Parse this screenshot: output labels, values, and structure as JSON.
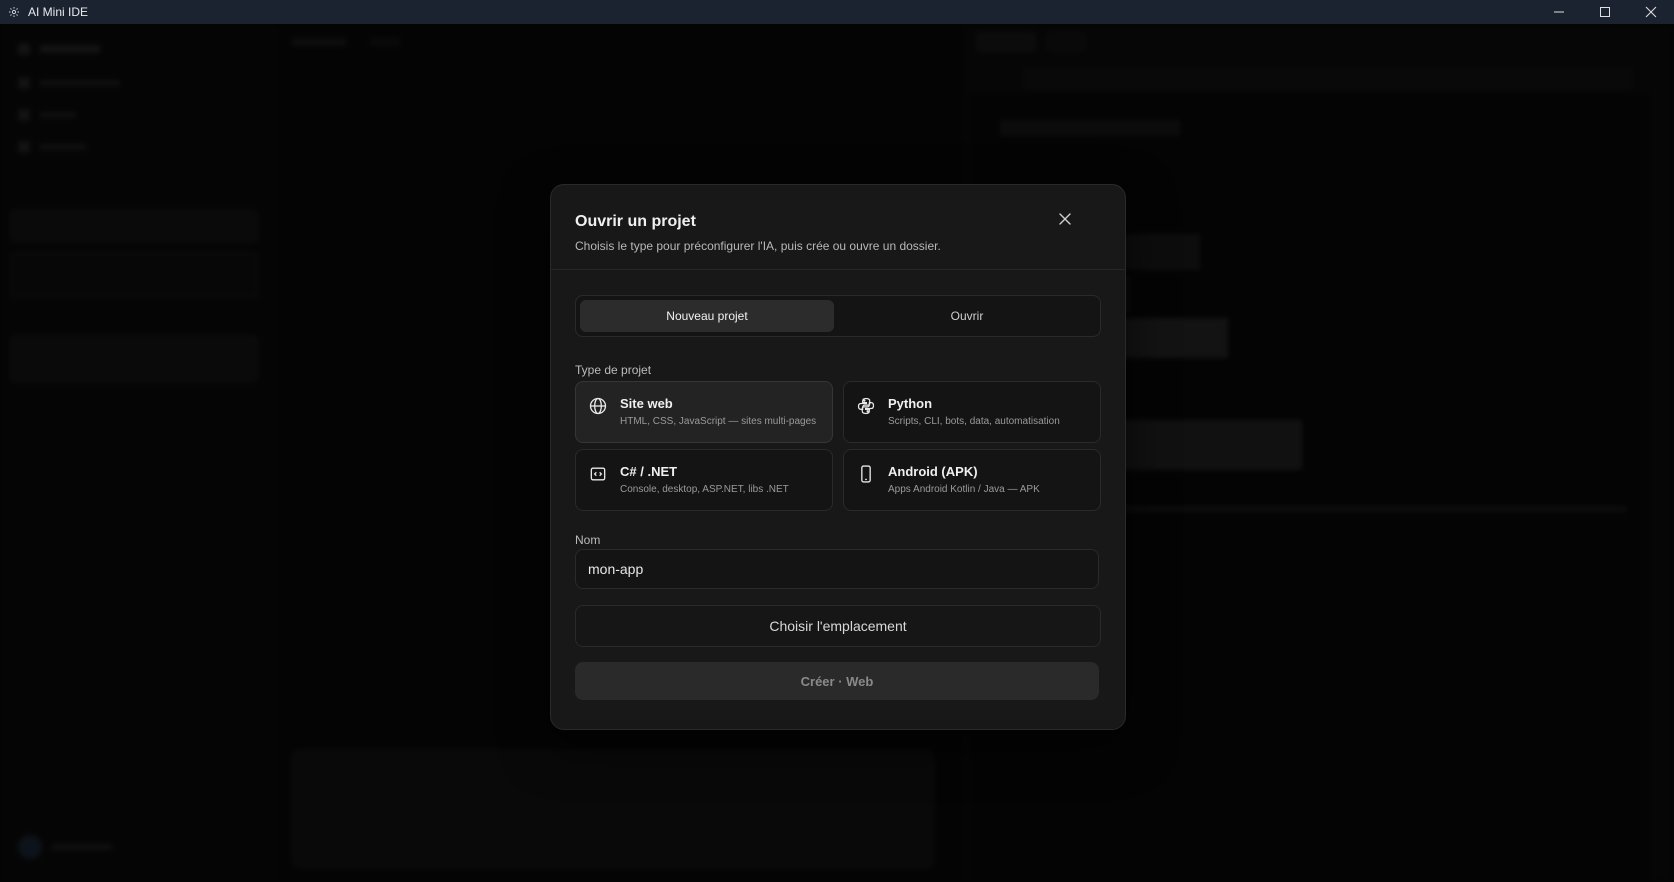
{
  "window": {
    "title": "AI Mini IDE",
    "app_icon": "gear-icon",
    "controls": [
      "minimize-icon",
      "maximize-icon",
      "close-icon"
    ]
  },
  "dialog": {
    "title": "Ouvrir un projet",
    "subtitle": "Choisis le type pour préconfigurer l'IA, puis crée ou ouvre un dossier.",
    "close_icon": "close-icon",
    "tabs": [
      {
        "label": "Nouveau projet",
        "active": true
      },
      {
        "label": "Ouvrir",
        "active": false
      }
    ],
    "project_type_label": "Type de projet",
    "project_types": [
      {
        "title": "Site web",
        "description": "HTML, CSS, JavaScript — sites multi-pages",
        "icon": "globe-icon",
        "selected": true
      },
      {
        "title": "Python",
        "description": "Scripts, CLI, bots, data, automatisation",
        "icon": "python-icon",
        "selected": false
      },
      {
        "title": "C# / .NET",
        "description": "Console, desktop, ASP.NET, libs .NET",
        "icon": "code-window-icon",
        "selected": false
      },
      {
        "title": "Android (APK)",
        "description": "Apps Android Kotlin / Java — APK",
        "icon": "smartphone-icon",
        "selected": false
      }
    ],
    "name_label": "Nom",
    "name_value": "mon-app",
    "choose_location_label": "Choisir l'emplacement",
    "create_label": "Créer · Web"
  },
  "colors": {
    "titlebar_bg": "#1c2330",
    "dialog_bg": "#181818",
    "overlay": "rgba(0,0,0,0.55)",
    "selected_card_bg": "#232323"
  }
}
